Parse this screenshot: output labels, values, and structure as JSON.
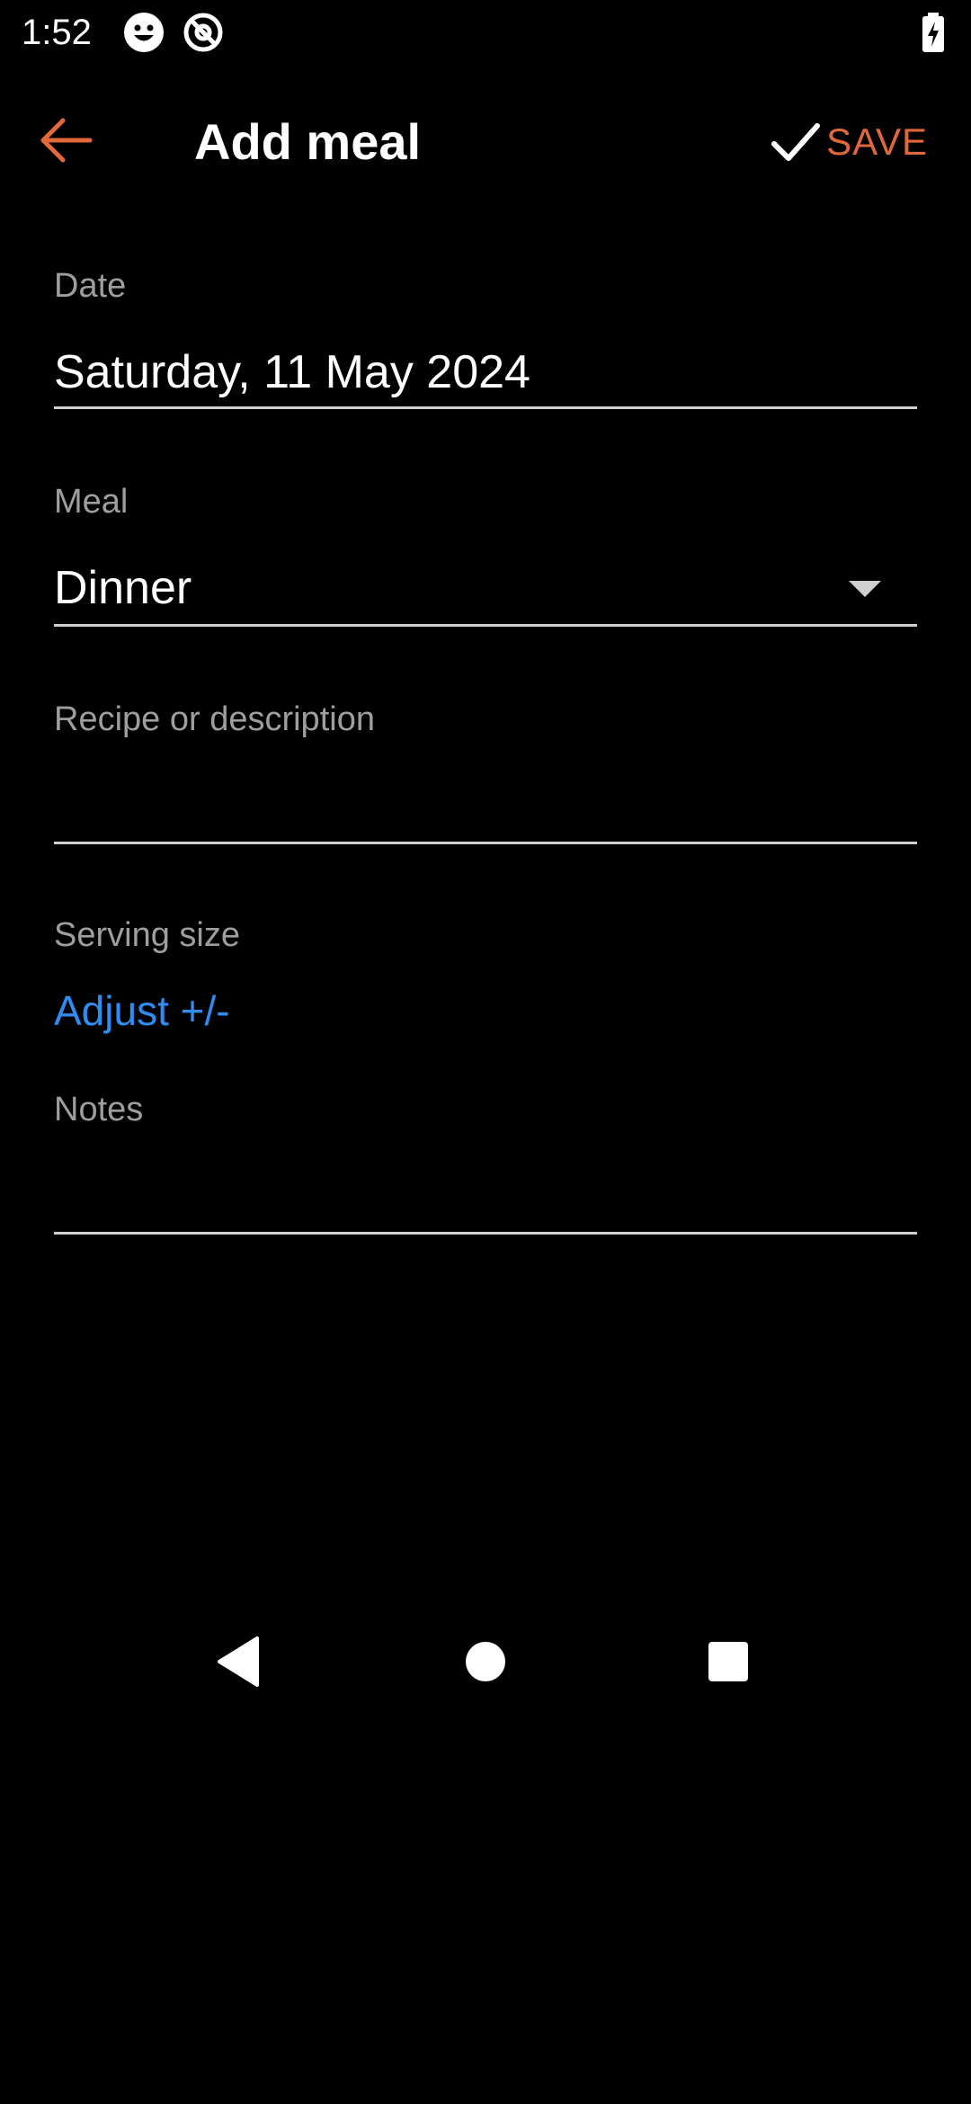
{
  "status_bar": {
    "time": "1:52",
    "icons": [
      "emoji-face-icon",
      "at-sign-icon",
      "battery-charging-icon"
    ]
  },
  "app_bar": {
    "title": "Add meal",
    "save_label": "SAVE",
    "back_icon": "arrow-left-icon",
    "save_icon": "check-icon"
  },
  "form": {
    "date": {
      "label": "Date",
      "value": "Saturday, 11 May 2024"
    },
    "meal": {
      "label": "Meal",
      "value": "Dinner"
    },
    "recipe": {
      "label": "Recipe or description",
      "value": ""
    },
    "serving_size": {
      "label": "Serving size",
      "adjust_label": "Adjust +/-"
    },
    "notes": {
      "label": "Notes",
      "value": ""
    }
  },
  "nav_bar": {
    "icons": [
      "nav-back-icon",
      "nav-home-icon",
      "nav-recents-icon"
    ]
  },
  "colors": {
    "accent": "#e0683a",
    "link": "#2f8cf0",
    "label": "#9e9e9e",
    "background": "#000000"
  }
}
